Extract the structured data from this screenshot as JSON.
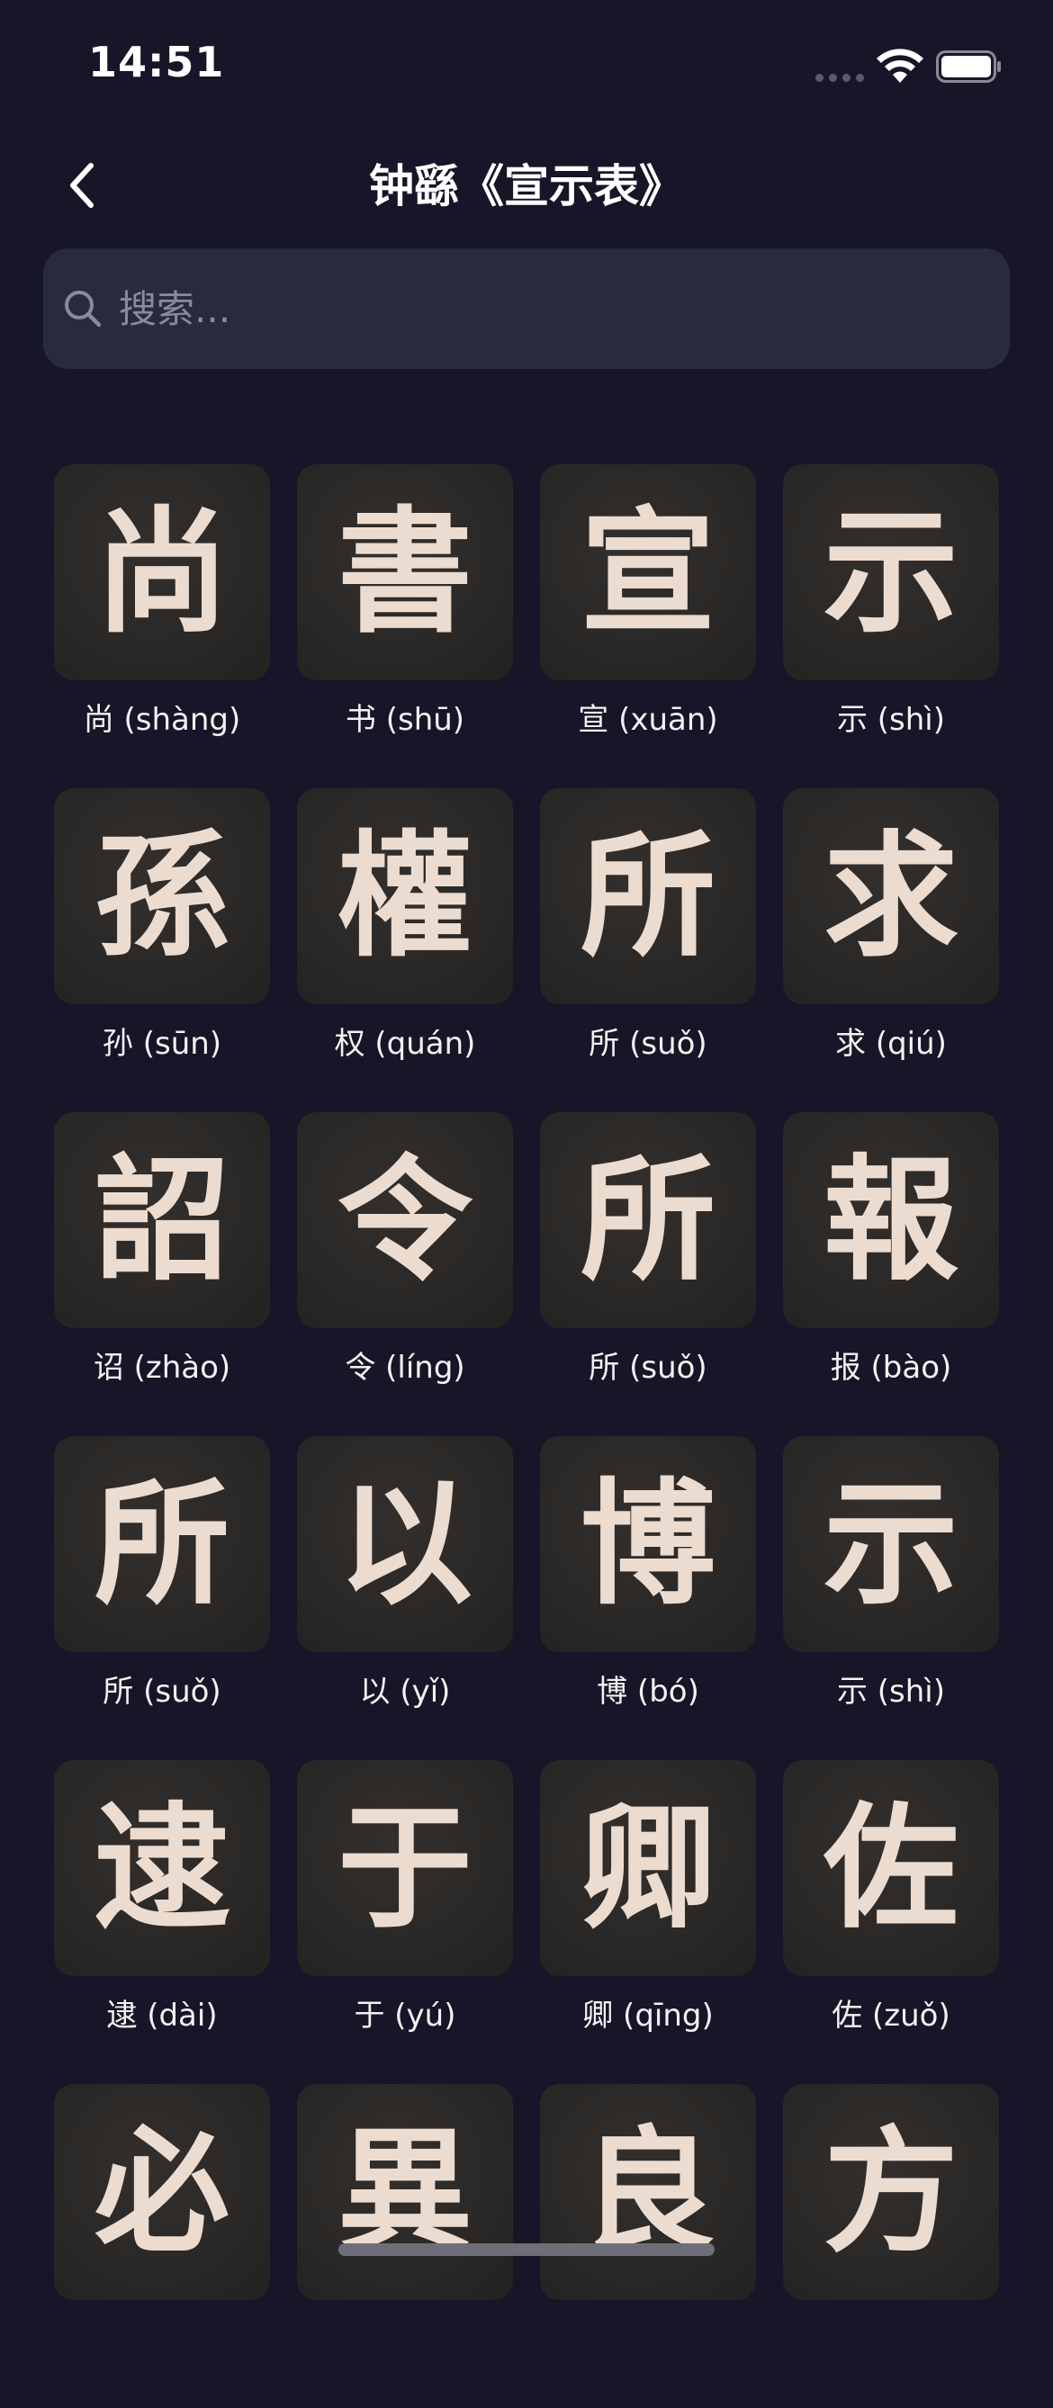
{
  "status_bar": {
    "time": "14:51"
  },
  "header": {
    "title": "钟繇《宣示表》"
  },
  "search": {
    "placeholder": "搜索..."
  },
  "characters": [
    {
      "glyph": "尚",
      "label": "尚 (shàng)"
    },
    {
      "glyph": "書",
      "label": "书 (shū)"
    },
    {
      "glyph": "宣",
      "label": "宣 (xuān)"
    },
    {
      "glyph": "示",
      "label": "示 (shì)"
    },
    {
      "glyph": "孫",
      "label": "孙 (sūn)"
    },
    {
      "glyph": "權",
      "label": "权 (quán)"
    },
    {
      "glyph": "所",
      "label": "所 (suǒ)"
    },
    {
      "glyph": "求",
      "label": "求 (qiú)"
    },
    {
      "glyph": "詔",
      "label": "诏 (zhào)"
    },
    {
      "glyph": "令",
      "label": "令 (líng)"
    },
    {
      "glyph": "所",
      "label": "所 (suǒ)"
    },
    {
      "glyph": "報",
      "label": "报 (bào)"
    },
    {
      "glyph": "所",
      "label": "所 (suǒ)"
    },
    {
      "glyph": "以",
      "label": "以 (yǐ)"
    },
    {
      "glyph": "博",
      "label": "博 (bó)"
    },
    {
      "glyph": "示",
      "label": "示 (shì)"
    },
    {
      "glyph": "逮",
      "label": "逮 (dài)"
    },
    {
      "glyph": "于",
      "label": "于 (yú)"
    },
    {
      "glyph": "卿",
      "label": "卿 (qīng)"
    },
    {
      "glyph": "佐",
      "label": "佐 (zuǒ)"
    },
    {
      "glyph": "必",
      "label": ""
    },
    {
      "glyph": "異",
      "label": ""
    },
    {
      "glyph": "良",
      "label": ""
    },
    {
      "glyph": "方",
      "label": ""
    }
  ]
}
